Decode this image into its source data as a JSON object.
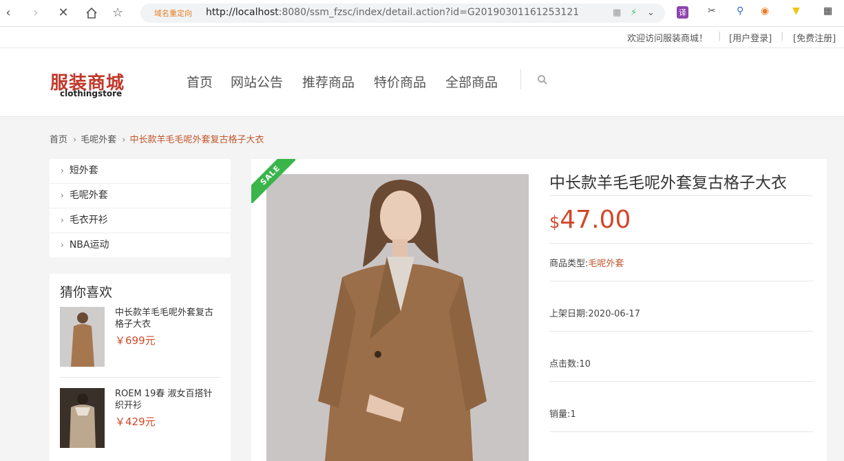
{
  "browser": {
    "redirect_label": "域名重定向",
    "url_host": "http://localhost",
    "url_rest": ":8080/ssm_fzsc/index/detail.action?id=G20190301161253121",
    "translate_label": "译"
  },
  "topbar": {
    "welcome": "欢迎访问服装商城！",
    "login": "[用户登录]",
    "register": "[免费注册]"
  },
  "logo": {
    "cn_part1": "服",
    "cn_part2": "装商城",
    "en": "clothingstore"
  },
  "menu": [
    "首页",
    "网站公告",
    "推荐商品",
    "特价商品",
    "全部商品"
  ],
  "breadcrumb": {
    "home": "首页",
    "category": "毛呢外套",
    "current": "中长款羊毛毛呢外套复古格子大衣"
  },
  "categories": [
    "短外套",
    "毛呢外套",
    "毛衣开衫",
    "NBA运动"
  ],
  "guess": {
    "title": "猜你喜欢",
    "items": [
      {
        "title": "中长款羊毛毛呢外套复古格子大衣",
        "price": "￥699元"
      },
      {
        "title": "ROEM 19春 淑女百搭针织开衫",
        "price": "￥429元"
      }
    ]
  },
  "product": {
    "badge": "SALE",
    "title": "中长款羊毛毛呢外套复古格子大衣",
    "currency": "$",
    "price": "47.00",
    "type_label": "商品类型:",
    "type_value": "毛呢外套",
    "date": "上架日期:2020-06-17",
    "clicks": "点击数:10",
    "sales": "销量:1"
  },
  "colors": {
    "accent": "#c0562b",
    "price": "#d0482a",
    "badge": "#39b54a"
  }
}
